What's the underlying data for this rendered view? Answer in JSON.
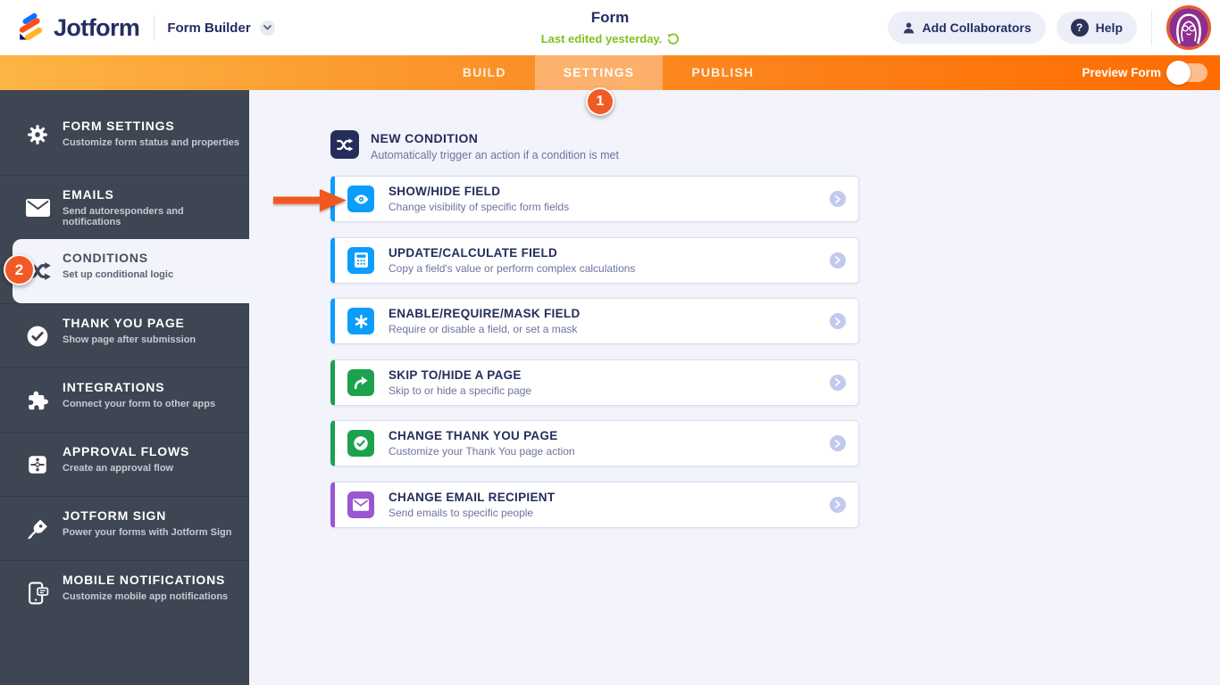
{
  "header": {
    "logo_text": "Jotform",
    "product_name": "Form Builder",
    "form_title": "Form",
    "last_edited": "Last edited yesterday.",
    "add_collaborators_label": "Add Collaborators",
    "help_label": "Help",
    "help_glyph": "?"
  },
  "nav": {
    "tabs": [
      {
        "label": "BUILD",
        "active": false
      },
      {
        "label": "SETTINGS",
        "active": true
      },
      {
        "label": "PUBLISH",
        "active": false
      }
    ],
    "preview_label": "Preview Form",
    "preview_toggle_state": "off"
  },
  "annotations": {
    "step1": "1",
    "step2": "2"
  },
  "sidebar": {
    "items": [
      {
        "label": "FORM SETTINGS",
        "desc": "Customize form status and properties",
        "icon": "gear-icon",
        "active": false
      },
      {
        "label": "EMAILS",
        "desc": "Send autoresponders and notifications",
        "icon": "envelope-icon",
        "active": false
      },
      {
        "label": "CONDITIONS",
        "desc": "Set up conditional logic",
        "icon": "shuffle-icon",
        "active": true
      },
      {
        "label": "THANK YOU PAGE",
        "desc": "Show page after submission",
        "icon": "check-circle-icon",
        "active": false
      },
      {
        "label": "INTEGRATIONS",
        "desc": "Connect your form to other apps",
        "icon": "puzzle-icon",
        "active": false
      },
      {
        "label": "APPROVAL FLOWS",
        "desc": "Create an approval flow",
        "icon": "approval-flow-icon",
        "active": false
      },
      {
        "label": "JOTFORM SIGN",
        "desc": "Power your forms with Jotform Sign",
        "icon": "pen-nib-icon",
        "active": false
      },
      {
        "label": "MOBILE NOTIFICATIONS",
        "desc": "Customize mobile app notifications",
        "icon": "mobile-notification-icon",
        "active": false
      }
    ]
  },
  "main": {
    "header": {
      "title": "NEW CONDITION",
      "desc": "Automatically trigger an action if a condition is met",
      "icon": "shuffle-icon"
    },
    "cards": [
      {
        "title": "SHOW/HIDE FIELD",
        "desc": "Change visibility of specific form fields",
        "color": "#0b9dfc",
        "icon": "eye-icon"
      },
      {
        "title": "UPDATE/CALCULATE FIELD",
        "desc": "Copy a field's value or perform complex calculations",
        "color": "#0b9dfc",
        "icon": "calculator-icon"
      },
      {
        "title": "ENABLE/REQUIRE/MASK FIELD",
        "desc": "Require or disable a field, or set a mask",
        "color": "#0b9dfc",
        "icon": "asterisk-icon"
      },
      {
        "title": "SKIP TO/HIDE A PAGE",
        "desc": "Skip to or hide a specific page",
        "color": "#1ca24c",
        "icon": "skip-arrow-icon"
      },
      {
        "title": "CHANGE THANK YOU PAGE",
        "desc": "Customize your Thank You page action",
        "color": "#1ca24c",
        "icon": "check-badge-icon"
      },
      {
        "title": "CHANGE EMAIL RECIPIENT",
        "desc": "Send emails to specific people",
        "color": "#9a57d3",
        "icon": "envelope-card-icon"
      }
    ]
  },
  "colors": {
    "brand_navy": "#252d5b",
    "nav_gradient_start": "#fcb544",
    "nav_gradient_end": "#ff6c00",
    "sidebar_bg": "#3e4653",
    "content_bg": "#f2f3fb",
    "annotation_orange": "#f15a24",
    "edited_green": "#7fc11e",
    "accent_blue": "#0b9dfc",
    "accent_green": "#1ca24c",
    "accent_purple": "#9a57d3"
  }
}
